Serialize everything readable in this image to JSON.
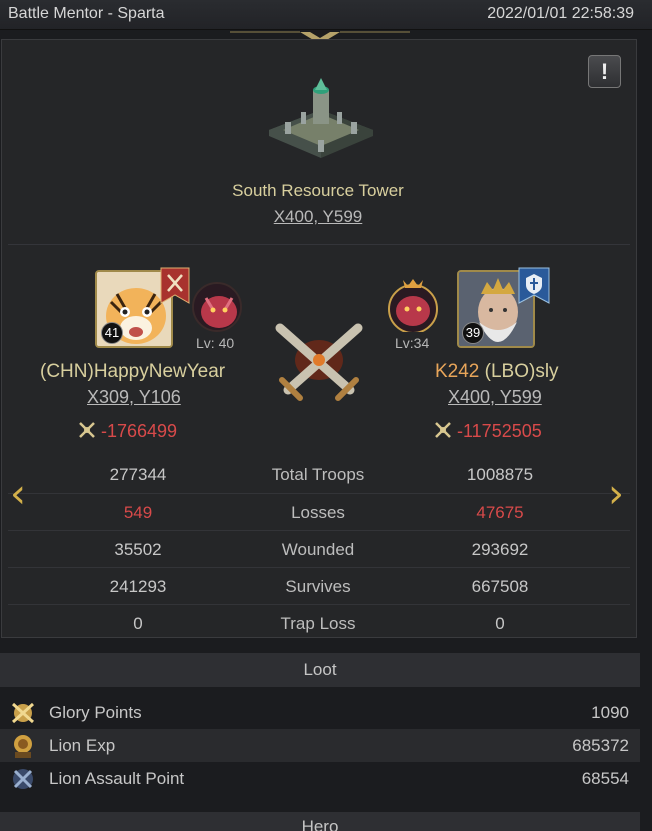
{
  "header": {
    "title": "Battle Mentor - Sparta",
    "datetime": "2022/01/01 22:58:39"
  },
  "alert": {
    "glyph": "!"
  },
  "location": {
    "name": "South Resource Tower",
    "coord": "X400, Y599"
  },
  "attacker": {
    "name": "(CHN)HappyNewYear",
    "level_badge": "41",
    "dragon_level": "Lv: 40",
    "coord": "X309, Y106",
    "power": "-1766499",
    "icon": "tiger-portrait-icon"
  },
  "defender": {
    "kingdom": "K242",
    "name": " (LBO)sly",
    "level_badge": "39",
    "dragon_level": "Lv:34",
    "coord": "X400, Y599",
    "power": "-11752505",
    "icon": "king-portrait-icon"
  },
  "stats": [
    {
      "label": "Total Troops",
      "attacker": "277344",
      "defender": "1008875"
    },
    {
      "label": "Losses",
      "attacker": "549",
      "defender": "47675"
    },
    {
      "label": "Wounded",
      "attacker": "35502",
      "defender": "293692"
    },
    {
      "label": "Survives",
      "attacker": "241293",
      "defender": "667508"
    },
    {
      "label": "Trap Loss",
      "attacker": "0",
      "defender": "0"
    }
  ],
  "nav": {
    "prev": "‹",
    "next": "›"
  },
  "loot": {
    "title": "Loot",
    "items": [
      {
        "name": "Glory Points",
        "value": "1090",
        "icon": "glory-points-icon"
      },
      {
        "name": "Lion Exp",
        "value": "685372",
        "icon": "lion-exp-icon"
      },
      {
        "name": "Lion Assault Point",
        "value": "68554",
        "icon": "lion-assault-icon"
      }
    ]
  },
  "hero": {
    "title": "Hero"
  },
  "colors": {
    "gold": "#d8cf9e",
    "red": "#d84a4a",
    "accent_orange": "#e8a55a"
  }
}
